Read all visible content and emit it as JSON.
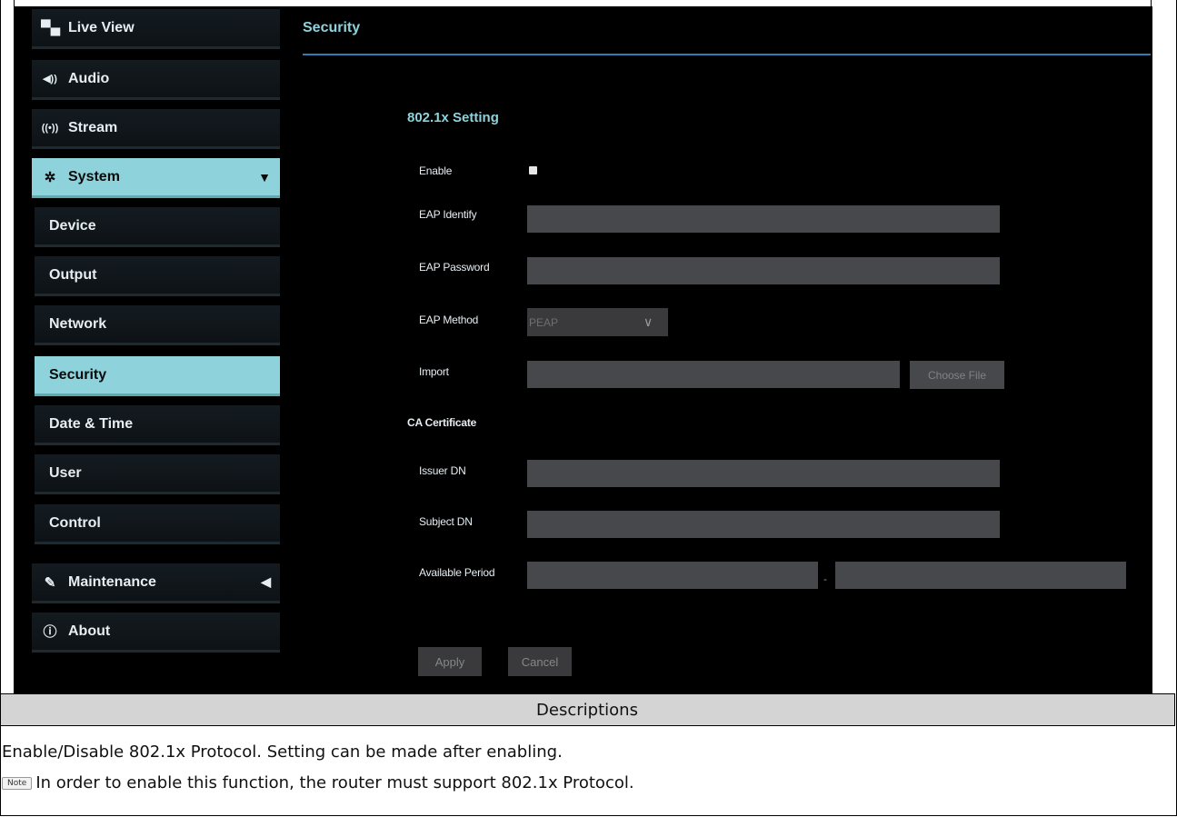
{
  "sidebar": {
    "items": [
      {
        "label": "Live View",
        "icon": "video-camera-icon"
      },
      {
        "label": "Audio",
        "icon": "speaker-icon"
      },
      {
        "label": "Stream",
        "icon": "broadcast-icon"
      },
      {
        "label": "System",
        "icon": "gear-icon",
        "arrow": "▼"
      },
      {
        "label": "Maintenance",
        "icon": "wrench-icon",
        "arrow": "◀"
      },
      {
        "label": "About",
        "icon": "info-icon"
      }
    ],
    "system_sub": [
      "Device",
      "Output",
      "Network",
      "Security",
      "Date & Time",
      "User",
      "Control"
    ],
    "active_sub": "Security"
  },
  "main": {
    "page_title": "Security",
    "section_title": "802.1x Setting",
    "labels": {
      "enable": "Enable",
      "eap_identify": "EAP Identify",
      "eap_password": "EAP Password",
      "eap_method": "EAP Method",
      "import": "Import",
      "ca_certificate": "CA Certificate",
      "issuer_dn": "Issuer DN",
      "subject_dn": "Subject DN",
      "available_period": "Available Period"
    },
    "eap_method_value": "PEAP",
    "choose_file_label": "Choose File",
    "period_separator": "-",
    "apply_label": "Apply",
    "cancel_label": "Cancel",
    "enable_checked": false
  },
  "descriptions": {
    "header": "Descriptions",
    "line1": "Enable/Disable 802.1x Protocol. Setting can be made after enabling.",
    "note_badge": "Note",
    "line2": "In order to enable this function, the router must support 802.1x Protocol."
  },
  "colors": {
    "accent": "#8ed3db",
    "rule": "#2a7fb6",
    "field": "#47484b",
    "background": "#000000"
  }
}
